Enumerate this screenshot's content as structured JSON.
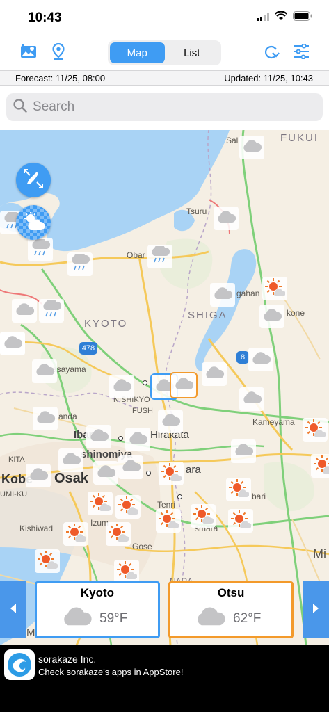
{
  "status": {
    "time": "10:43"
  },
  "nav": {
    "segments": [
      {
        "label": "Map",
        "active": true
      },
      {
        "label": "List",
        "active": false
      }
    ]
  },
  "info": {
    "forecast": "Forecast: 11/25, 08:00",
    "updated": "Updated: 11/25, 10:43"
  },
  "search": {
    "placeholder": "Search"
  },
  "map": {
    "regions": [
      "KYOTO",
      "SHIGA",
      "FUKUI"
    ],
    "cities": [
      "Sal",
      "Tsuru",
      "Obar",
      "gahan",
      "kone",
      "Kameyama",
      "Kobe",
      "Osak",
      "shinomiya",
      "Ibar",
      "Hirakata",
      "ara",
      "Tenri",
      "Kishiwad",
      "Izum",
      "Gose",
      "bari",
      "smara",
      "anda",
      "asayama",
      "NISHIKYO",
      "FUSH",
      "KITA",
      "UMI-KU",
      "Mi",
      "NARA",
      "Ma"
    ],
    "road_badges": [
      "478",
      "8"
    ],
    "weather_icons": {
      "cloudy": "cloud-icon",
      "rain": "rain-icon",
      "sunny": "sun-cloud-icon"
    }
  },
  "cards": [
    {
      "city": "Kyoto",
      "temp": "59°F",
      "icon": "cloud-icon",
      "border": "#3f9cf3"
    },
    {
      "city": "Otsu",
      "temp": "62°F",
      "icon": "cloud-icon",
      "border": "#f39a2b"
    }
  ],
  "ad": {
    "title": "sorakaze Inc.",
    "subtitle": "Check sorakaze's apps in AppStore!"
  },
  "colors": {
    "accent": "#3f9cf3",
    "highlight": "#f39a2b",
    "water": "#a9d3f5",
    "land": "#f5efe4"
  }
}
